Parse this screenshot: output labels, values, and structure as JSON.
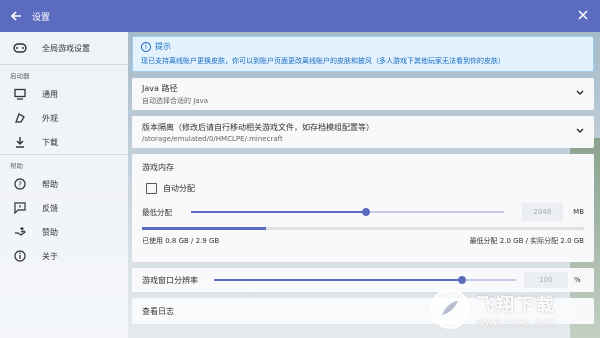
{
  "titlebar": {
    "title": "设置"
  },
  "sidebar": {
    "global": "全局游戏设置",
    "group_launcher": "启动器",
    "items_launcher": [
      {
        "label": "通用",
        "icon": "monitor-icon"
      },
      {
        "label": "外观",
        "icon": "palette-icon"
      },
      {
        "label": "下载",
        "icon": "download-icon"
      }
    ],
    "group_help": "帮助",
    "items_help": [
      {
        "label": "帮助",
        "icon": "help-icon"
      },
      {
        "label": "反馈",
        "icon": "feedback-icon"
      },
      {
        "label": "赞助",
        "icon": "sponsor-icon"
      },
      {
        "label": "关于",
        "icon": "about-icon"
      }
    ]
  },
  "tip": {
    "title": "提示",
    "body": "现已支持离线账户更换皮肤，你可以到账户页面更改离线账户的皮肤和披风（多人游戏下其他玩家无法看到你的皮肤）"
  },
  "java": {
    "title": "Java 路径",
    "subtitle": "自动选择合适的 Java"
  },
  "isolation": {
    "title": "版本隔离（修改后请自行移动相关游戏文件，如存档模组配置等）",
    "subtitle": "/storage/emulated/0/HMCLPE/.minecraft"
  },
  "memory": {
    "title": "游戏内存",
    "auto_label": "自动分配",
    "min_label": "最低分配",
    "min_value": "2048",
    "unit": "MB",
    "slider_fraction": 0.56,
    "used_fraction": 0.28,
    "used_text": "已使用 0.8 GB / 2.9 GB",
    "alloc_text": "最低分配 2.0 GB / 实际分配 2.0 GB"
  },
  "resolution": {
    "label": "游戏窗口分辨率",
    "value": "100",
    "unit": "%",
    "slider_fraction": 0.82
  },
  "logs": {
    "label": "查看日志"
  },
  "watermark": {
    "cn": "飞翔下载",
    "url": "WWW.FXXZ.COM"
  }
}
